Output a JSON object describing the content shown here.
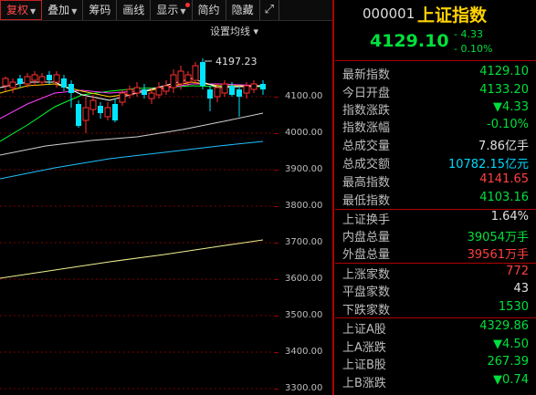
{
  "toolbar": {
    "buttons": [
      "复权",
      "叠加",
      "筹码",
      "画线",
      "显示",
      "简约",
      "隐藏"
    ],
    "expand_icon": "expand-icon"
  },
  "chart": {
    "settings_label": "设置均线",
    "high_annotation": "4197.23",
    "y_labels": [
      "4100.00",
      "4000.00",
      "3900.00",
      "3800.00",
      "3700.00",
      "3600.00",
      "3500.00",
      "3400.00",
      "3300.00"
    ],
    "colors": {
      "up": "#ff3030",
      "down": "#00e5ff",
      "ma5": "#ffffff",
      "ma10": "#ffd200",
      "ma20": "#ff40ff",
      "ma30": "#00ff30",
      "ma60": "#cfcfcf",
      "ma120": "#20c0ff",
      "ma250": "#f0f090"
    }
  },
  "quote": {
    "code": "000001",
    "name": "上证指数",
    "price": "4129.10",
    "change": "- 4.33",
    "change_pct": "- 0.10%",
    "rows": [
      {
        "label": "最新指数",
        "value": "4129.10",
        "color": "g"
      },
      {
        "label": "今日开盘",
        "value": "4133.20",
        "color": "g"
      },
      {
        "label": "指数涨跌",
        "value": "▼4.33",
        "color": "g"
      },
      {
        "label": "指数涨幅",
        "value": "-0.10%",
        "color": "g"
      },
      {
        "label": "总成交量",
        "value": "7.86亿手",
        "color": "w"
      },
      {
        "label": "总成交额",
        "value": "10782.15亿元",
        "color": "c"
      },
      {
        "label": "最高指数",
        "value": "4141.65",
        "color": "r"
      },
      {
        "label": "最低指数",
        "value": "4103.16",
        "color": "g"
      },
      {
        "label": "上证换手",
        "value": "1.64%",
        "color": "w"
      },
      {
        "label": "内盘总量",
        "value": "39054万手",
        "color": "g"
      },
      {
        "label": "外盘总量",
        "value": "39561万手",
        "color": "r"
      },
      {
        "label": "上涨家数",
        "value": "772",
        "color": "r"
      },
      {
        "label": "平盘家数",
        "value": "43",
        "color": "w"
      },
      {
        "label": "下跌家数",
        "value": "1530",
        "color": "g"
      },
      {
        "label": "上证A股",
        "value": "4329.86",
        "color": "g"
      },
      {
        "label": "上A涨跌",
        "value": "▼4.50",
        "color": "g"
      },
      {
        "label": "上证B股",
        "value": "267.39",
        "color": "g"
      },
      {
        "label": "上B涨跌",
        "value": "▼0.74",
        "color": "g"
      }
    ]
  }
}
